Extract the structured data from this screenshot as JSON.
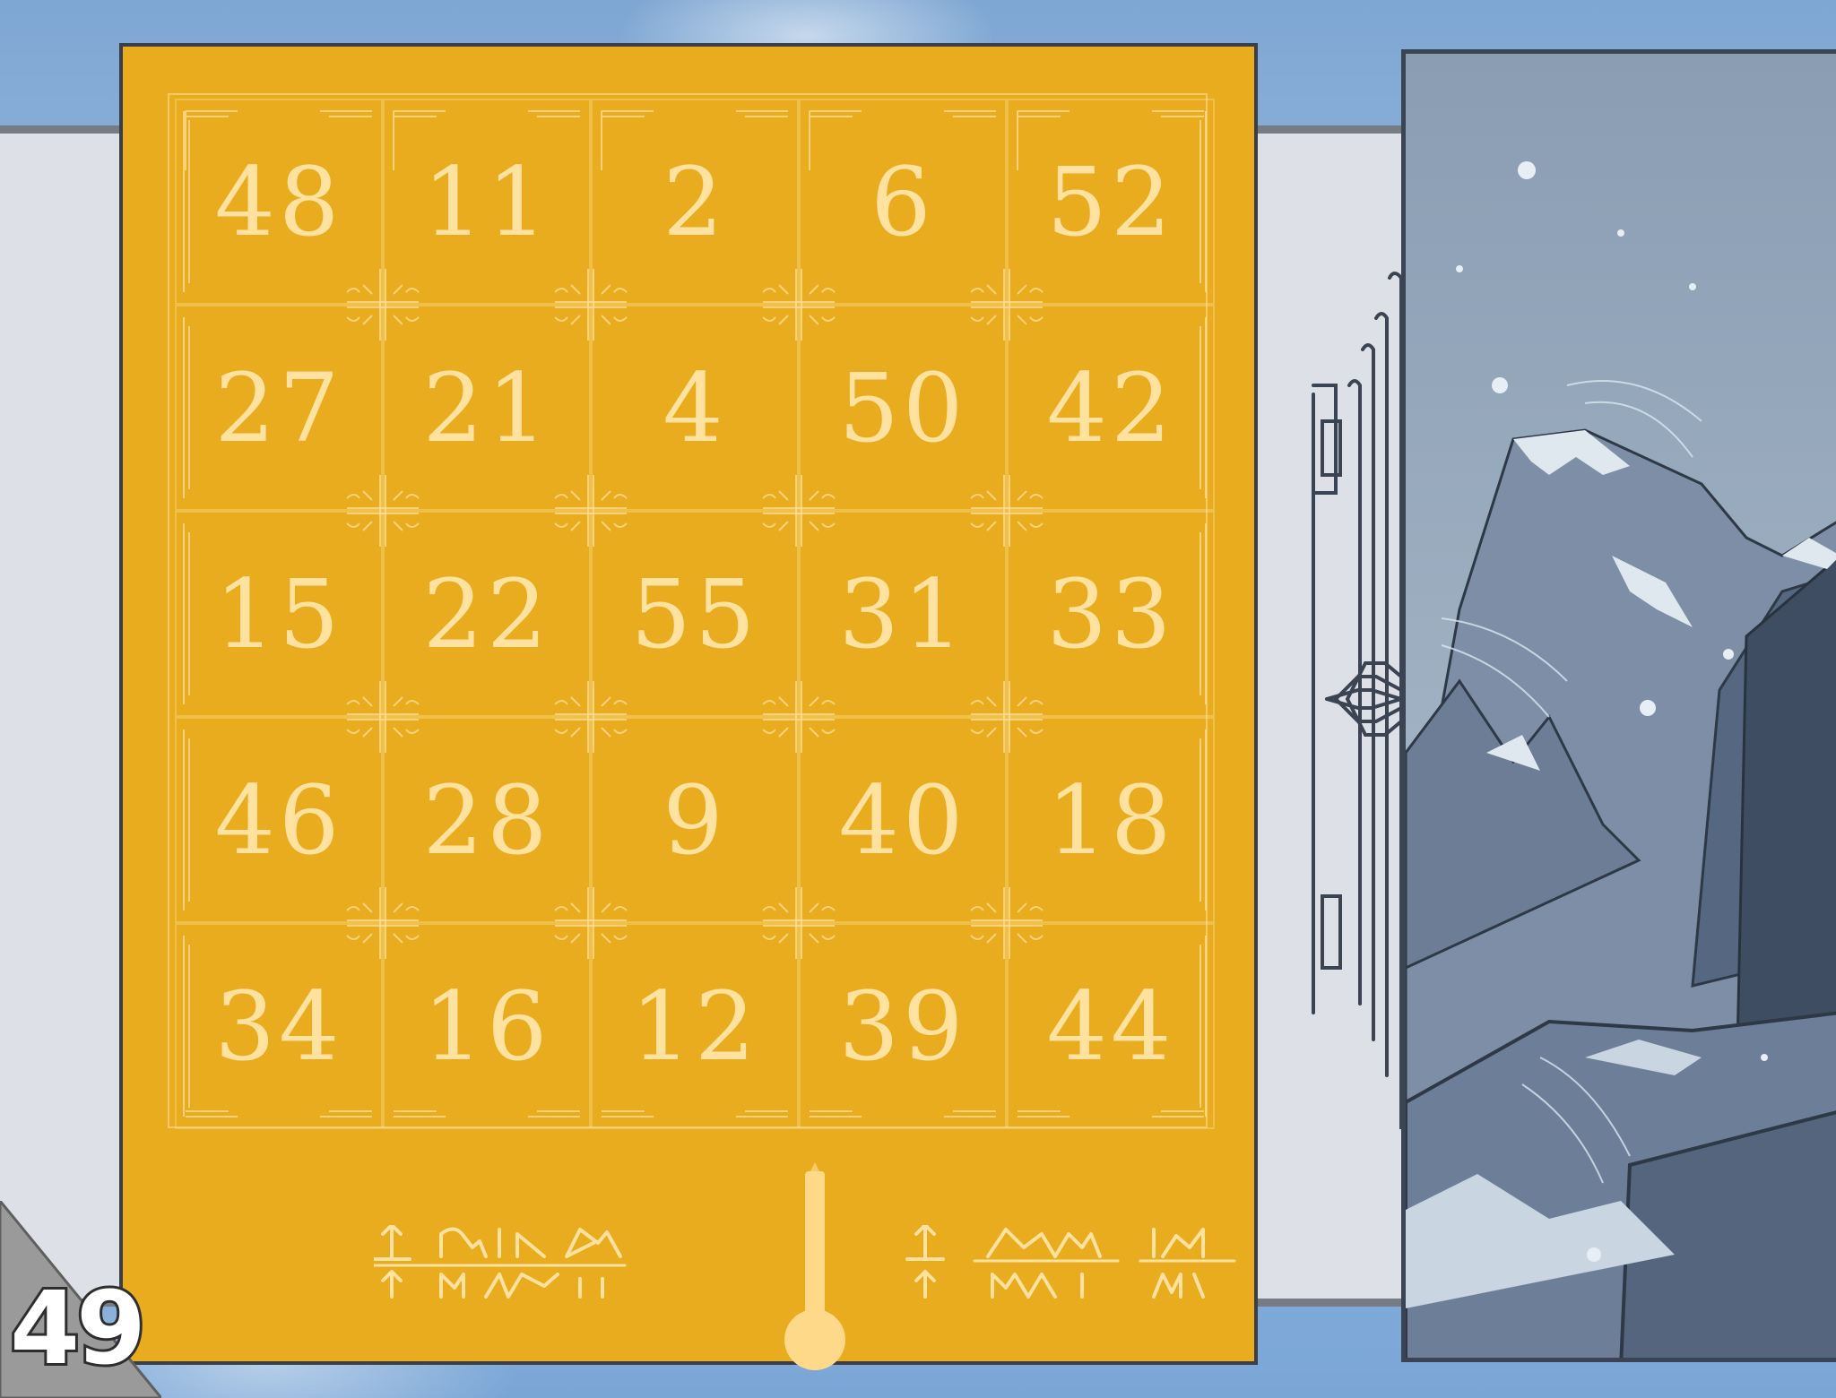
{
  "page_number": "49",
  "grid": {
    "rows": [
      [
        "48",
        "11",
        "2",
        "6",
        "52"
      ],
      [
        "27",
        "21",
        "4",
        "50",
        "42"
      ],
      [
        "15",
        "22",
        "55",
        "31",
        "33"
      ],
      [
        "46",
        "28",
        "9",
        "40",
        "18"
      ],
      [
        "34",
        "16",
        "12",
        "39",
        "44"
      ]
    ]
  },
  "colors": {
    "card": "#e8ac1e",
    "numbers": "#ffe1a0",
    "band": "#dde0e6",
    "sky": "#8fb6dc",
    "mountain": "#5f7088"
  },
  "icons": [
    "thermometer-icon",
    "rune-glyphs",
    "snowy-mountain-scene",
    "circuit-connector"
  ]
}
